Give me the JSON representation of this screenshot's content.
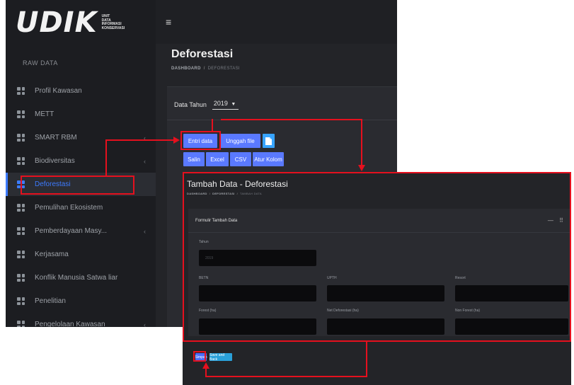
{
  "logo": {
    "big": "UDIK",
    "small": [
      "UNIT",
      "DATA",
      "INFORMASI",
      "KONSERVASI"
    ]
  },
  "sidebar": {
    "section_label": "RAW DATA",
    "items": [
      {
        "label": "Profil Kawasan",
        "icon": "grid-icon",
        "active": false,
        "has_chevron": false
      },
      {
        "label": "METT",
        "icon": "grid-icon",
        "active": false,
        "has_chevron": false
      },
      {
        "label": "SMART RBM",
        "icon": "grid-icon",
        "active": false,
        "has_chevron": true
      },
      {
        "label": "Biodiversitas",
        "icon": "grid-icon",
        "active": false,
        "has_chevron": true
      },
      {
        "label": "Deforestasi",
        "icon": "grid-icon",
        "active": true,
        "has_chevron": false
      },
      {
        "label": "Pemulihan Ekosistem",
        "icon": "grid-icon",
        "active": false,
        "has_chevron": false
      },
      {
        "label": "Pemberdayaan Masy...",
        "icon": "grid-icon",
        "active": false,
        "has_chevron": true
      },
      {
        "label": "Kerjasama",
        "icon": "grid-icon",
        "active": false,
        "has_chevron": false
      },
      {
        "label": "Konflik Manusia Satwa liar",
        "icon": "grid-icon",
        "active": false,
        "has_chevron": false
      },
      {
        "label": "Penelitian",
        "icon": "grid-icon",
        "active": false,
        "has_chevron": false
      },
      {
        "label": "Pengelolaan Kawasan",
        "icon": "grid-icon",
        "active": false,
        "has_chevron": true
      }
    ]
  },
  "topbar": {
    "menu_icon": "≡"
  },
  "page": {
    "title": "Deforestasi",
    "breadcrumb": [
      "DASHBOARD",
      "DEFORESTASI"
    ],
    "year_label": "Data Tahun",
    "year_value": "2019",
    "year_caret": "▼"
  },
  "actions": {
    "entri_data": "Entri data",
    "unggah_file": "Unggah file",
    "file_icon": "file-icon",
    "salin": "Salin",
    "excel": "Excel",
    "csv": "CSV",
    "atur_kolom": "Atur Kolom"
  },
  "form": {
    "title": "Tambah Data - Deforestasi",
    "breadcrumb": [
      "DASHBOARD",
      "DEFORESTASI",
      "TAMBAH DATA"
    ],
    "card_title": "Formulir Tambah Data",
    "tools": "— ⠿",
    "fields": {
      "tahun": {
        "label": "Tahun",
        "value": "2019"
      },
      "betn": {
        "label": "BETN",
        "value": ""
      },
      "upth": {
        "label": "UPTH",
        "value": ""
      },
      "resort": {
        "label": "Resort",
        "value": ""
      },
      "forest": {
        "label": "Forest (ha)",
        "value": ""
      },
      "net_deforestasi": {
        "label": "Net Deforestasi (ha)",
        "value": ""
      },
      "non_forest": {
        "label": "Non Forest (ha)",
        "value": ""
      }
    },
    "simpan": "Simpan",
    "save_back": "Save and Back"
  },
  "colors": {
    "callout": "#e5101e",
    "primary_button": "#5a79ff",
    "active_nav": "#3d7bff"
  }
}
